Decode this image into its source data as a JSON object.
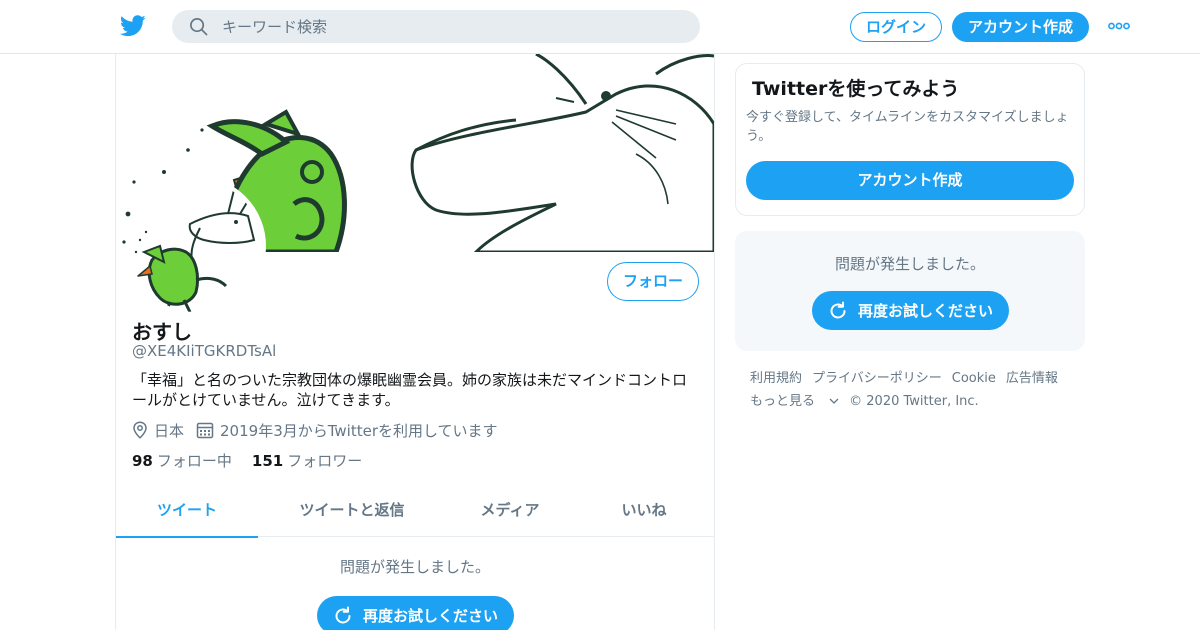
{
  "header": {
    "search_placeholder": "キーワード検索",
    "login_label": "ログイン",
    "signup_label": "アカウント作成"
  },
  "profile": {
    "follow_label": "フォロー",
    "name": "おすし",
    "handle": "@XE4KIiTGKRDTsAl",
    "bio": "「幸福」と名のついた宗教団体の爆眠幽霊会員。姉の家族は未だマインドコントロールがとけていません。泣けてきます。",
    "location": "日本",
    "joined": "2019年3月からTwitterを利用しています",
    "following_count": "98",
    "following_label": "フォロー中",
    "followers_count": "151",
    "followers_label": "フォロワー"
  },
  "tabs": [
    {
      "label": "ツイート",
      "active": true
    },
    {
      "label": "ツイートと返信",
      "active": false
    },
    {
      "label": "メディア",
      "active": false
    },
    {
      "label": "いいね",
      "active": false
    }
  ],
  "feed": {
    "error_text": "問題が発生しました。",
    "retry_label": "再度お試しください"
  },
  "sidebar": {
    "signup_card": {
      "title": "Twitterを使ってみよう",
      "description": "今すぐ登録して、タイムラインをカスタマイズしましょう。",
      "button_label": "アカウント作成"
    },
    "error_card": {
      "error_text": "問題が発生しました。",
      "retry_label": "再度お試しください"
    },
    "footer": {
      "terms": "利用規約",
      "privacy": "プライバシーポリシー",
      "cookie": "Cookie",
      "ads": "広告情報",
      "more": "もっと見る",
      "copyright": "© 2020 Twitter, Inc."
    }
  },
  "colors": {
    "accent": "#1da1f2",
    "secondary_text": "#657786",
    "primary_text": "#14171a",
    "border": "#e6ecf0",
    "frog_green": "#6ccf3a"
  },
  "icons": [
    "twitter-bird-icon",
    "search-icon",
    "more-dots-icon",
    "location-pin-icon",
    "calendar-icon",
    "refresh-icon",
    "chevron-down-icon"
  ]
}
